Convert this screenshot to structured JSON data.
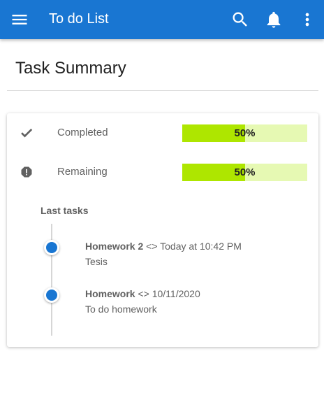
{
  "appbar": {
    "title": "To do List",
    "icons": [
      "menu-icon",
      "search-icon",
      "bell-icon",
      "more-vert-icon"
    ]
  },
  "page": {
    "title": "Task Summary"
  },
  "summary": {
    "completed": {
      "label": "Completed",
      "percent_text": "50%",
      "value": 0.5,
      "icon": "check-icon"
    },
    "remaining": {
      "label": "Remaining",
      "percent_text": "50%",
      "value": 0.5,
      "icon": "alert-octagon-icon"
    }
  },
  "last_tasks": {
    "title": "Last tasks",
    "items": [
      {
        "name": "Homework 2",
        "sep": " <> ",
        "date": "Today at 10:42 PM",
        "desc": "Tesis"
      },
      {
        "name": "Homework",
        "sep": " <> ",
        "date": "10/11/2020",
        "desc": "To do homework"
      }
    ]
  },
  "colors": {
    "primary": "#1976d2",
    "bar_fill": "#aee600",
    "bar_track": "#e6f9b3"
  }
}
